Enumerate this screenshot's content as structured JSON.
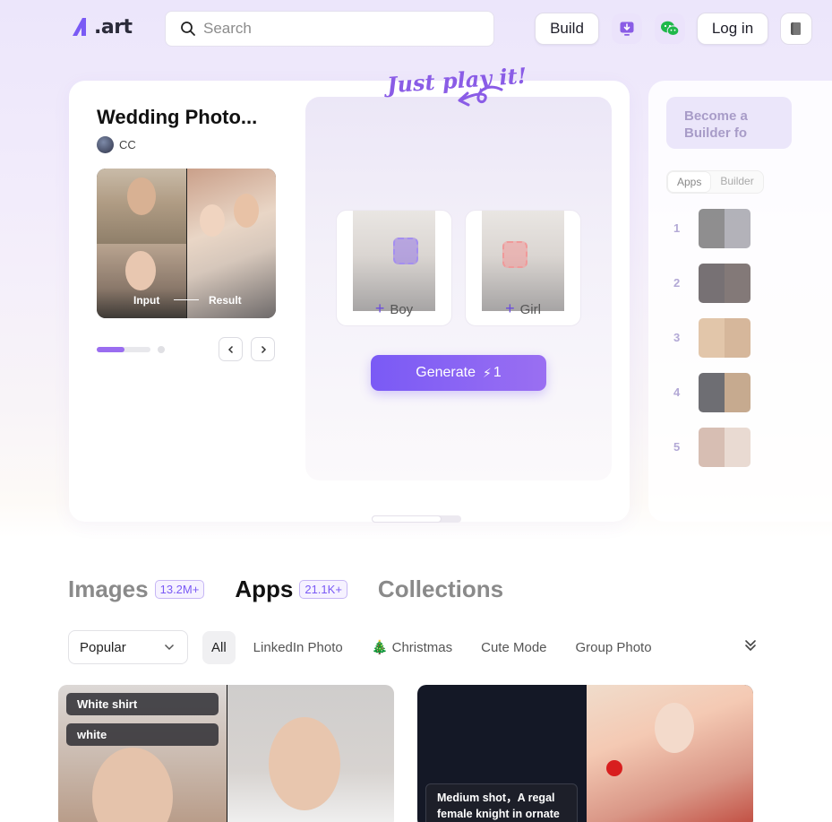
{
  "header": {
    "logo_text": ".art",
    "search_placeholder": "Search",
    "build_label": "Build",
    "login_label": "Log in"
  },
  "hero": {
    "title": "Wedding Photo...",
    "author": "CC",
    "input_caption": "Input",
    "result_caption": "Result",
    "tagline": "Just play it!",
    "boy_label": "Boy",
    "girl_label": "Girl",
    "generate_label": "Generate",
    "generate_cost": "1"
  },
  "side_panel": {
    "become_text": "Become a\nBuilder fo",
    "tabs": [
      "Apps",
      "Builder"
    ],
    "ranks": [
      "1",
      "2",
      "3",
      "4",
      "5"
    ]
  },
  "categories": [
    {
      "label": "Images",
      "count": "13.2M+"
    },
    {
      "label": "Apps",
      "count": "21.1K+"
    },
    {
      "label": "Collections",
      "count": ""
    }
  ],
  "filters": {
    "sort": "Popular",
    "chips": [
      "All",
      "LinkedIn Photo",
      "Christmas",
      "Cute Mode",
      "Group Photo"
    ]
  },
  "cards": {
    "card1_tags": [
      "White shirt",
      "white"
    ],
    "card2_prompt": "Medium shot，A regal female knight in ornate"
  },
  "colors": {
    "accent": "#7a5af5",
    "page_bg_top": "#ece6fb"
  }
}
